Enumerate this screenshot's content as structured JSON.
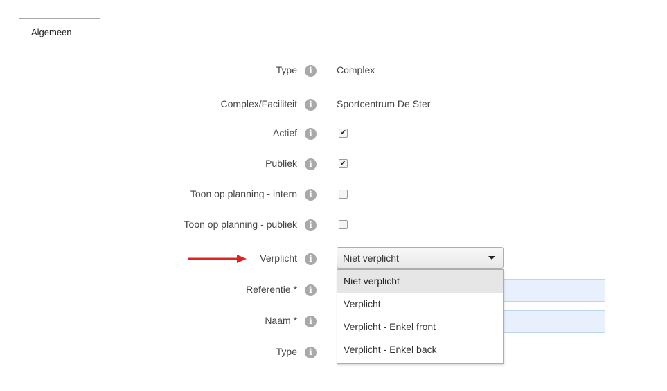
{
  "tabs": [
    {
      "label": "Algemeen",
      "active": true
    }
  ],
  "fields": {
    "type": {
      "label": "Type",
      "value": "Complex"
    },
    "complex": {
      "label": "Complex/Faciliteit",
      "value": "Sportcentrum De Ster"
    },
    "actief": {
      "label": "Actief",
      "checked": true
    },
    "publiek": {
      "label": "Publiek",
      "checked": true
    },
    "toon_intern": {
      "label": "Toon op planning - intern",
      "checked": false
    },
    "toon_publiek": {
      "label": "Toon op planning - publiek",
      "checked": false
    },
    "verplicht": {
      "label": "Verplicht",
      "selected": "Niet verplicht",
      "options": [
        "Niet verplicht",
        "Verplicht",
        "Verplicht - Enkel front",
        "Verplicht - Enkel back"
      ]
    },
    "referentie": {
      "label": "Referentie *",
      "value": ""
    },
    "naam": {
      "label": "Naam *",
      "value": ""
    },
    "type2": {
      "label": "Type"
    }
  },
  "icons": {
    "info": "info-icon",
    "check": "✔"
  },
  "colors": {
    "annotation_arrow": "#e0231c",
    "info_icon": "#a9a9a9",
    "field_bg": "#e8f0fe"
  }
}
